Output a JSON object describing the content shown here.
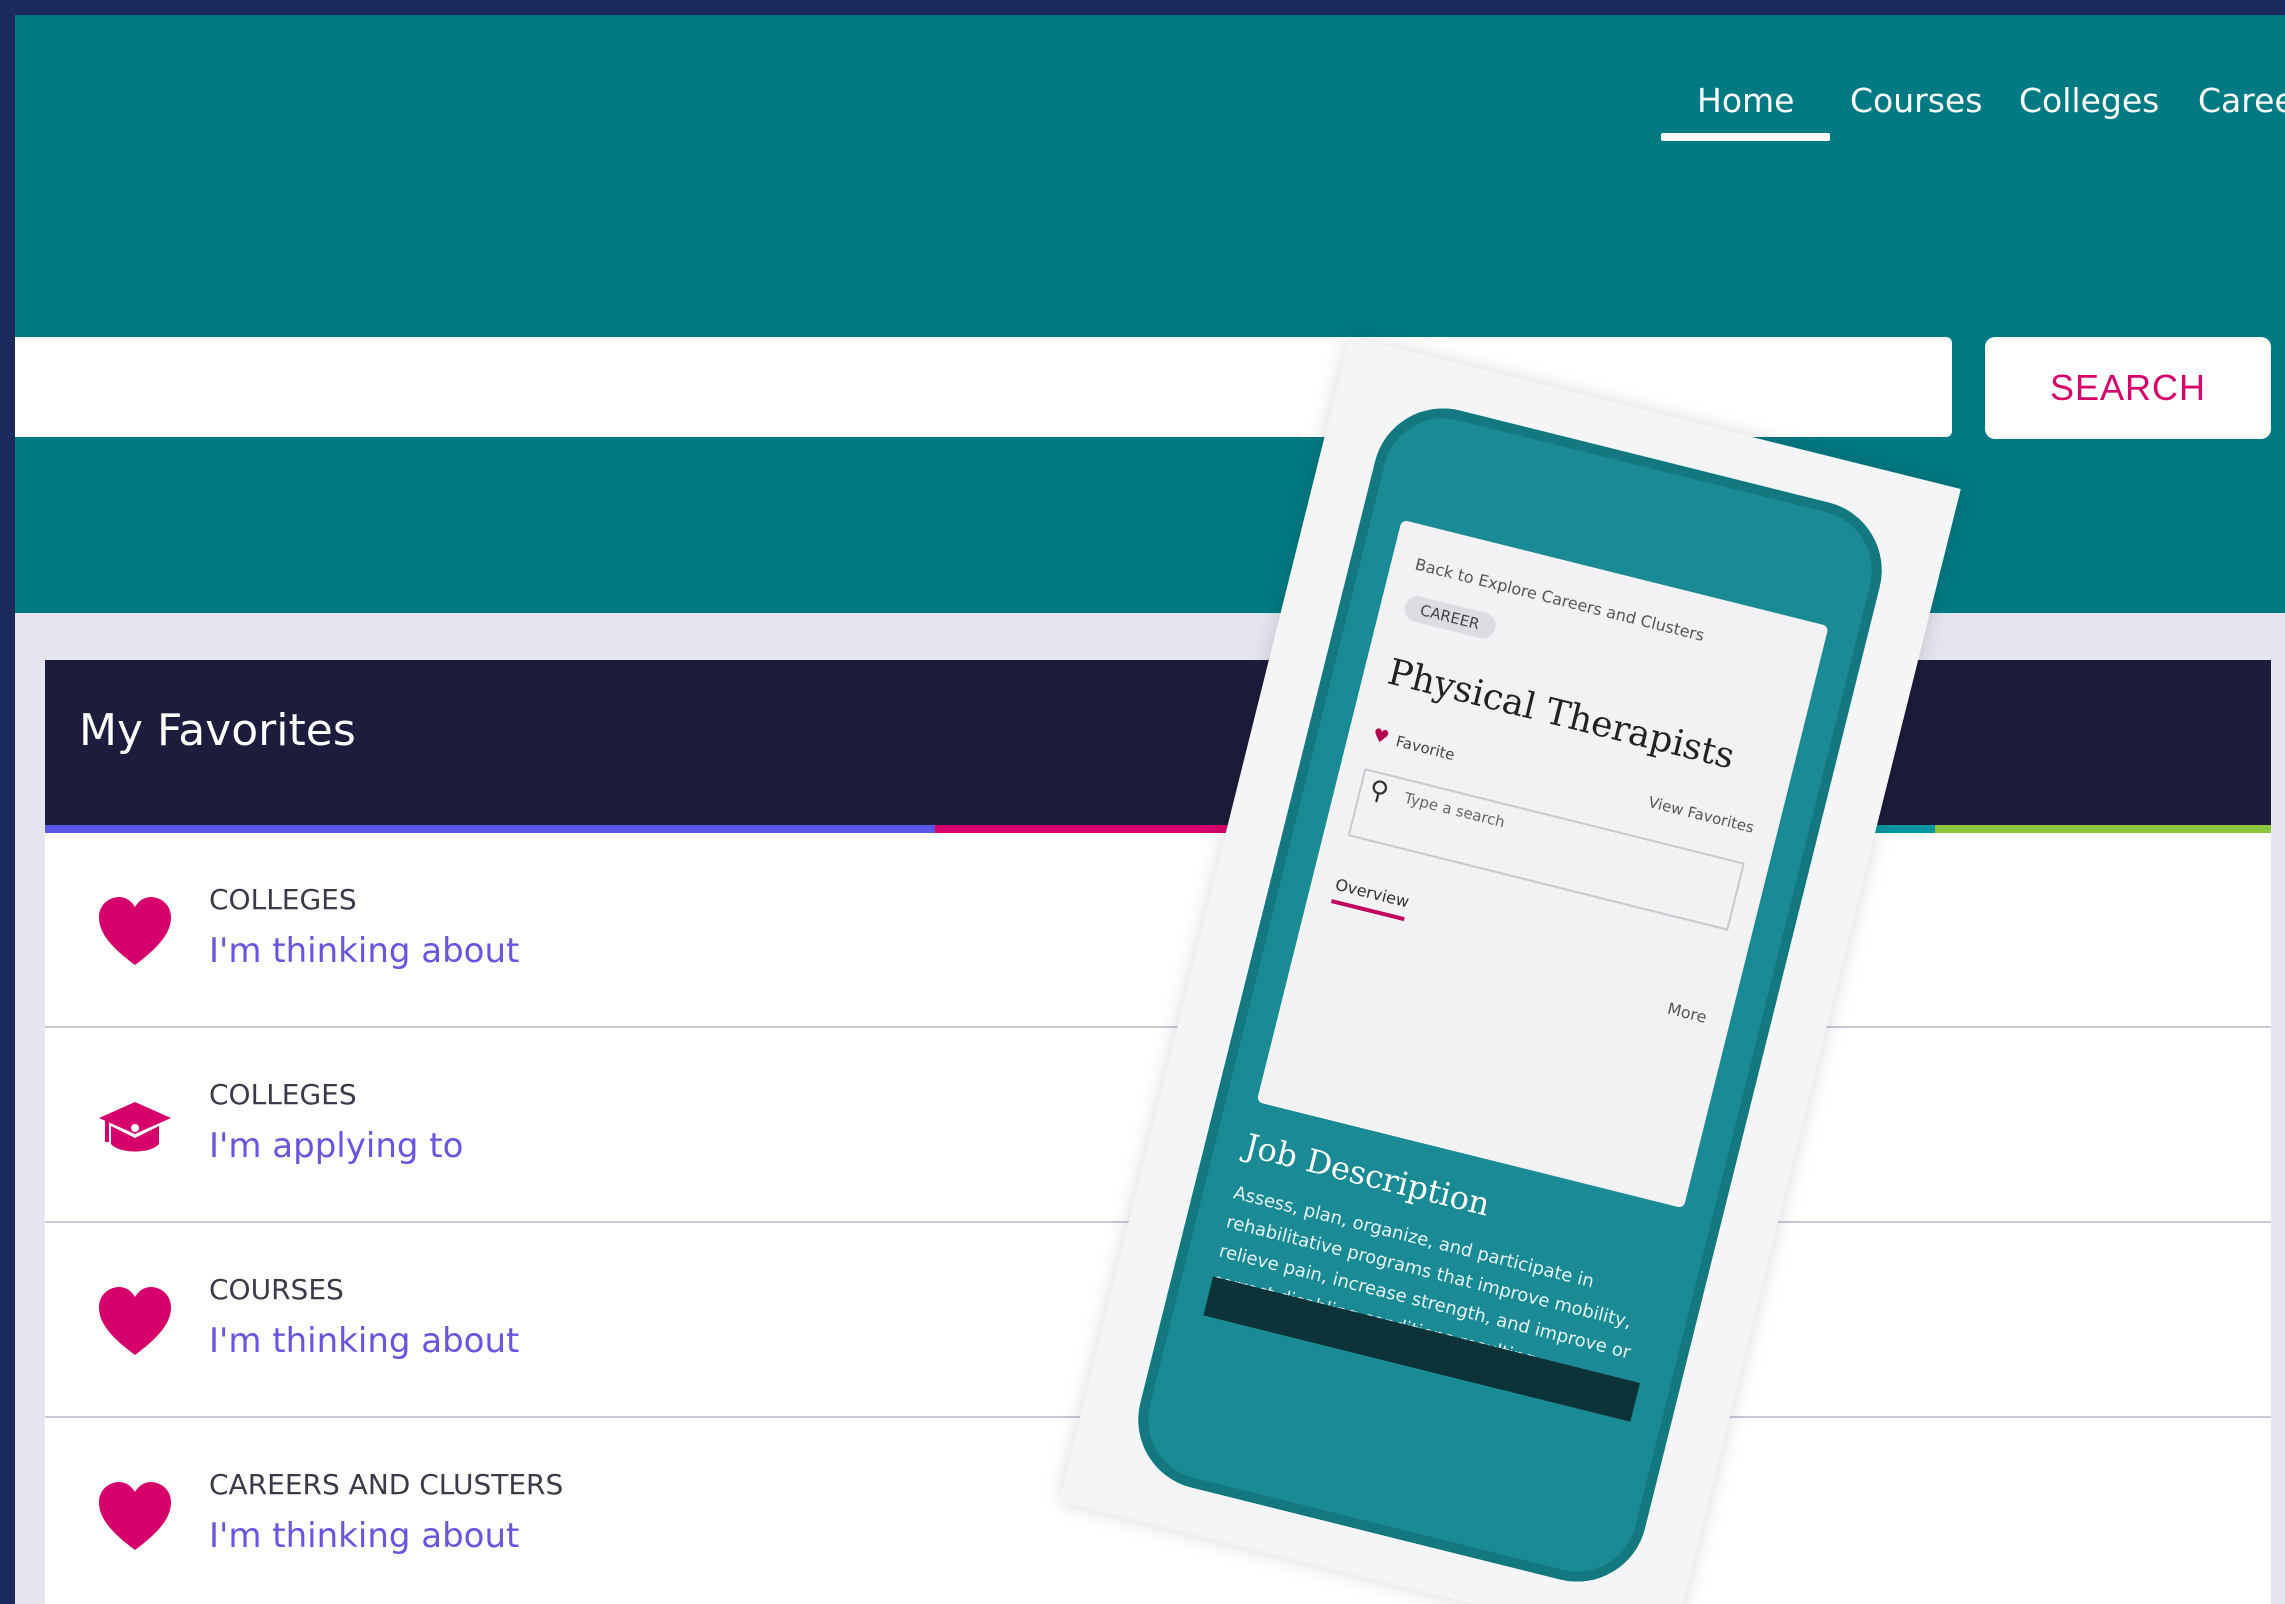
{
  "nav": {
    "items": [
      {
        "label": "Home",
        "active": true
      },
      {
        "label": "Courses",
        "active": false
      },
      {
        "label": "Colleges",
        "active": false
      },
      {
        "label": "Careers",
        "active": false
      }
    ]
  },
  "search": {
    "value": "",
    "placeholder": "",
    "button_label": "SEARCH"
  },
  "favorites": {
    "title": "My Favorites",
    "rows": [
      {
        "icon": "heart-icon",
        "category": "COLLEGES",
        "link": "I'm thinking about"
      },
      {
        "icon": "graduation-cap-icon",
        "category": "COLLEGES",
        "link": "I'm applying to"
      },
      {
        "icon": "heart-icon",
        "category": "COURSES",
        "link": "I'm thinking about"
      },
      {
        "icon": "heart-icon",
        "category": "CAREERS AND CLUSTERS",
        "link": "I'm thinking about"
      }
    ]
  },
  "phone": {
    "back_link": "Back to Explore Careers and Clusters",
    "chip": "CAREER",
    "title": "Physical Therapists",
    "favorite_label": "Favorite",
    "view_favorites": "View Favorites",
    "search_placeholder": "Type a search",
    "tab": "Overview",
    "more": "More",
    "job_title": "Job Description",
    "job_desc": "Assess, plan, organize, and participate in rehabilitative programs that improve mobility, relieve pain, increase strength, and improve or correct disabling conditions resulting"
  },
  "colors": {
    "hero": "#007a82",
    "header": "#1c1c3c",
    "accent_pink": "#d6006b",
    "link": "#6a54e0",
    "bar_purple": "#5a56e6",
    "bar_magenta": "#d6006b",
    "bar_teal": "#0096a0",
    "bar_green": "#8cc63f"
  }
}
